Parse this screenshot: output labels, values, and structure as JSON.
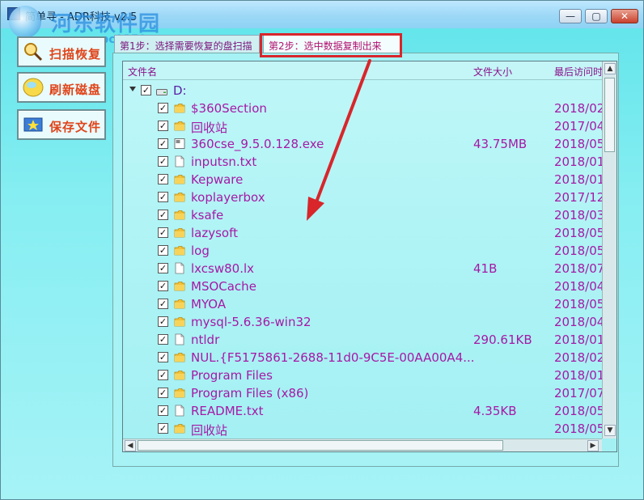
{
  "window": {
    "title": "简单寻 - ADR科技 v2.5",
    "minimize_label": "—",
    "maximize_label": "▢",
    "close_label": "✕"
  },
  "watermark": {
    "text": "河东软件园",
    "url": "www.pc0359.cn"
  },
  "sidebar": {
    "scan_label": "扫描恢复",
    "refresh_label": "刷新磁盘",
    "save_label": "保存文件"
  },
  "tabs": [
    {
      "label": "第1步：选择需要恢复的盘扫描"
    },
    {
      "label": "第2步：选中数据复制出来"
    }
  ],
  "list": {
    "columns": {
      "name": "文件名",
      "size": "文件大小",
      "date": "最后访问时"
    },
    "drive": "D:",
    "rows": [
      {
        "name": "$360Section",
        "size": "",
        "date": "2018/02",
        "icon": "folder-icon"
      },
      {
        "name": "回收站",
        "size": "",
        "date": "2017/04",
        "icon": "folder-icon"
      },
      {
        "name": "360cse_9.5.0.128.exe",
        "size": "43.75MB",
        "date": "2018/05",
        "icon": "exe-icon"
      },
      {
        "name": "inputsn.txt",
        "size": "",
        "date": "2018/01",
        "icon": "file-icon"
      },
      {
        "name": "Kepware",
        "size": "",
        "date": "2018/01",
        "icon": "folder-icon"
      },
      {
        "name": "koplayerbox",
        "size": "",
        "date": "2017/12",
        "icon": "folder-icon"
      },
      {
        "name": "ksafe",
        "size": "",
        "date": "2018/03",
        "icon": "folder-icon"
      },
      {
        "name": "lazysoft",
        "size": "",
        "date": "2018/05",
        "icon": "folder-icon"
      },
      {
        "name": "log",
        "size": "",
        "date": "2018/05",
        "icon": "folder-icon"
      },
      {
        "name": "lxcsw80.lx",
        "size": "41B",
        "date": "2018/07",
        "icon": "file-icon"
      },
      {
        "name": "MSOCache",
        "size": "",
        "date": "2018/04",
        "icon": "folder-icon"
      },
      {
        "name": "MYOA",
        "size": "",
        "date": "2018/05",
        "icon": "folder-icon"
      },
      {
        "name": "mysql-5.6.36-win32",
        "size": "",
        "date": "2018/04",
        "icon": "folder-icon"
      },
      {
        "name": "ntldr",
        "size": "290.61KB",
        "date": "2018/01",
        "icon": "file-icon"
      },
      {
        "name": "NUL.{F5175861-2688-11d0-9C5E-00AA00A4...",
        "size": "",
        "date": "2018/02",
        "icon": "folder-icon"
      },
      {
        "name": "Program Files",
        "size": "",
        "date": "2018/01",
        "icon": "folder-icon"
      },
      {
        "name": "Program Files (x86)",
        "size": "",
        "date": "2017/07",
        "icon": "folder-icon"
      },
      {
        "name": "README.txt",
        "size": "4.35KB",
        "date": "2018/05",
        "icon": "file-icon"
      },
      {
        "name": "回收站",
        "size": "",
        "date": "2018/05",
        "icon": "folder-icon"
      }
    ]
  },
  "colors": {
    "text": "#a619a6",
    "accent_red": "#d8262b",
    "sidebar_label": "#e0451b"
  }
}
